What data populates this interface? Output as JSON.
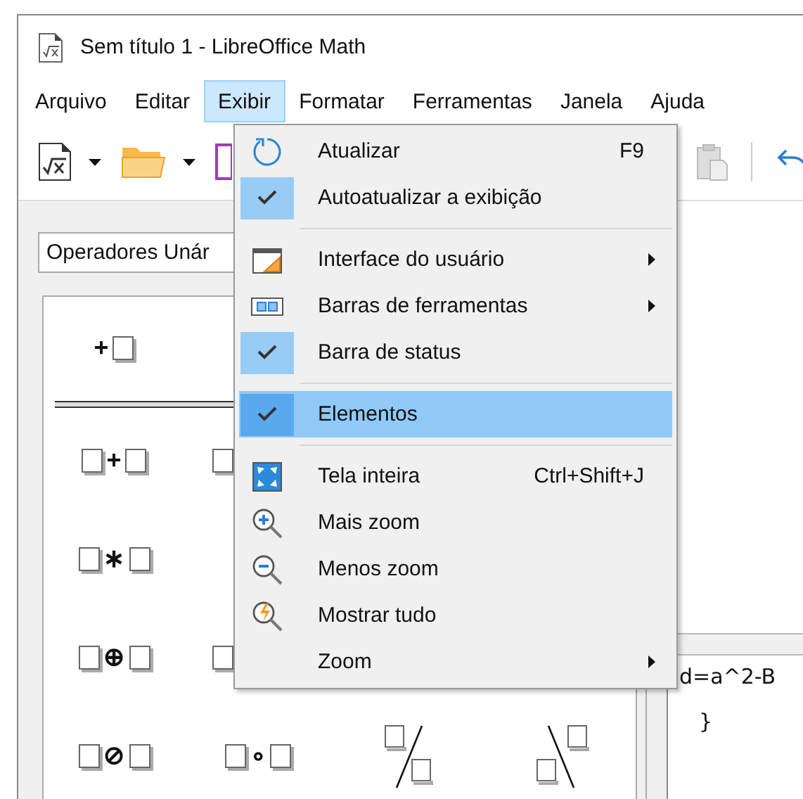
{
  "window": {
    "title": "Sem título 1 - LibreOffice Math"
  },
  "menubar": [
    {
      "label": "Arquivo",
      "selected": false
    },
    {
      "label": "Editar",
      "selected": false
    },
    {
      "label": "Exibir",
      "selected": true
    },
    {
      "label": "Formatar",
      "selected": false
    },
    {
      "label": "Ferramentas",
      "selected": false
    },
    {
      "label": "Janela",
      "selected": false
    },
    {
      "label": "Ajuda",
      "selected": false
    }
  ],
  "open_menu": {
    "items": [
      {
        "kind": "item",
        "label": "Atualizar",
        "shortcut": "F9",
        "selected": false
      },
      {
        "kind": "check",
        "label": "Autoatualizar a exibição",
        "checked": true,
        "selected": false
      },
      {
        "kind": "separator"
      },
      {
        "kind": "submenu",
        "label": "Interface do usuário",
        "selected": false
      },
      {
        "kind": "submenu",
        "label": "Barras de ferramentas",
        "selected": false
      },
      {
        "kind": "check",
        "label": "Barra de status",
        "checked": true,
        "selected": false
      },
      {
        "kind": "separator"
      },
      {
        "kind": "check",
        "label": "Elementos",
        "checked": true,
        "selected": true
      },
      {
        "kind": "separator"
      },
      {
        "kind": "item",
        "label": "Tela inteira",
        "shortcut": "Ctrl+Shift+J",
        "selected": false
      },
      {
        "kind": "item",
        "label": "Mais zoom",
        "selected": false
      },
      {
        "kind": "item",
        "label": "Menos zoom",
        "selected": false
      },
      {
        "kind": "item",
        "label": "Mostrar tudo",
        "selected": false
      },
      {
        "kind": "submenu",
        "label": "Zoom",
        "selected": false
      }
    ]
  },
  "elements_panel": {
    "category": "Operadores Unár",
    "rows": [
      {
        "kind": "cells",
        "cells": [
          {
            "kind": "unary",
            "op": "+"
          }
        ]
      },
      {
        "kind": "separator"
      },
      {
        "kind": "cells",
        "cells": [
          {
            "kind": "binary",
            "op": "+"
          },
          {
            "kind": "placeholder"
          }
        ]
      },
      {
        "kind": "cells",
        "cells": [
          {
            "kind": "binary",
            "op": "∗"
          }
        ]
      },
      {
        "kind": "cells",
        "cells": [
          {
            "kind": "binary",
            "op": "⊕"
          },
          {
            "kind": "placeholder"
          }
        ]
      },
      {
        "kind": "cells",
        "cells": [
          {
            "kind": "binary",
            "op": "⊘"
          },
          {
            "kind": "binary",
            "op": "∘"
          },
          {
            "kind": "slash_fraction"
          },
          {
            "kind": "backslash_fraction"
          }
        ]
      }
    ]
  },
  "editor": {
    "lines": [
      "d=a^2-B",
      "}"
    ]
  }
}
